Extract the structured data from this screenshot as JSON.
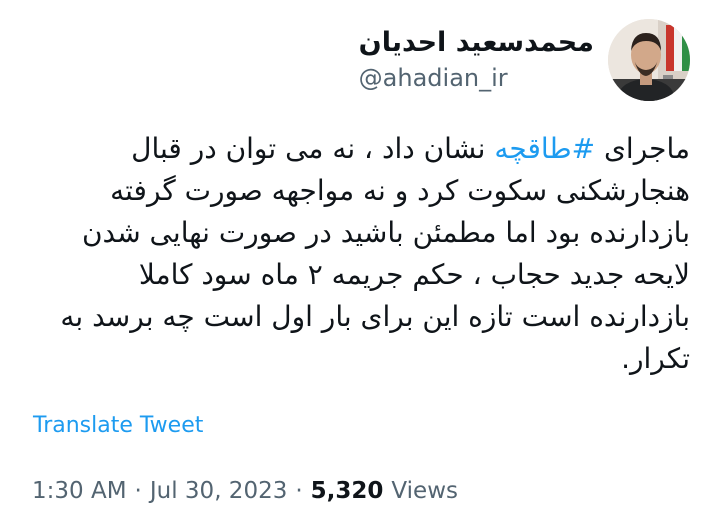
{
  "author": {
    "display_name": "محمدسعید احدیان",
    "handle": "@ahadian_ir"
  },
  "tweet": {
    "lines": [
      {
        "before": "ماجرای ",
        "hashtag": "#طاقچه",
        "after": " نشان داد ، نه می توان در قبال"
      },
      {
        "text": "هنجارشکنی سکوت کرد و نه مواجهه صورت گرفته"
      },
      {
        "text": "بازدارنده بود  اما مطمئن باشید در صورت نهایی شدن"
      },
      {
        "text": "لایحه جدید حجاب ، حکم جریمه ۲ ماه سود  کاملا"
      },
      {
        "text": "بازدارنده است تازه این برای بار اول است چه برسد به"
      },
      {
        "text": "تکرار."
      }
    ]
  },
  "translate_label": "Translate Tweet",
  "meta": {
    "time": "1:30 AM",
    "separator": "·",
    "date": "Jul 30, 2023",
    "views_count": "5,320",
    "views_label": "Views"
  },
  "icons": {
    "more": "more-dots-icon"
  },
  "colors": {
    "accent": "#1d9bf0",
    "secondary_text": "#536471",
    "primary_text": "#0f1419"
  }
}
